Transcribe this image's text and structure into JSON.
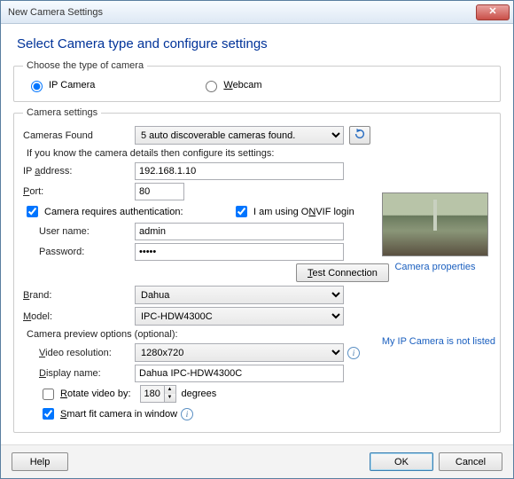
{
  "title": "New Camera Settings",
  "heading": "Select Camera type and configure settings",
  "groups": {
    "type_legend": "Choose the type of camera",
    "settings_legend": "Camera settings"
  },
  "radios": {
    "ip": "IP Camera",
    "webcam": "Webcam"
  },
  "labels": {
    "cameras_found": "Cameras Found",
    "hint": "If you know the camera details then configure its settings:",
    "ip_address": "IP address:",
    "port": "Port:",
    "requires_auth": "Camera requires authentication:",
    "onvif": "I am using ONVIF login",
    "username": "User name:",
    "password": "Password:",
    "test": "Test Connection",
    "brand": "Brand:",
    "model": "Model:",
    "preview_opts": "Camera preview options (optional):",
    "resolution": "Video resolution:",
    "display_name": "Display name:",
    "rotate": "Rotate video by:",
    "degrees": "degrees",
    "smart_fit": "Smart fit camera in window",
    "camera_props": "Camera properties",
    "not_listed": "My IP Camera is not listed"
  },
  "values": {
    "cameras_found": "5 auto discoverable cameras found.",
    "ip_address": "192.168.1.10",
    "port": "80",
    "username": "admin",
    "password": "•••••",
    "brand": "Dahua",
    "model": "IPC-HDW4300C",
    "resolution": "1280x720",
    "display_name": "Dahua IPC-HDW4300C",
    "rotate": "180"
  },
  "checks": {
    "requires_auth": true,
    "onvif": true,
    "rotate": false,
    "smart_fit": true
  },
  "footer": {
    "help": "Help",
    "ok": "OK",
    "cancel": "Cancel"
  }
}
